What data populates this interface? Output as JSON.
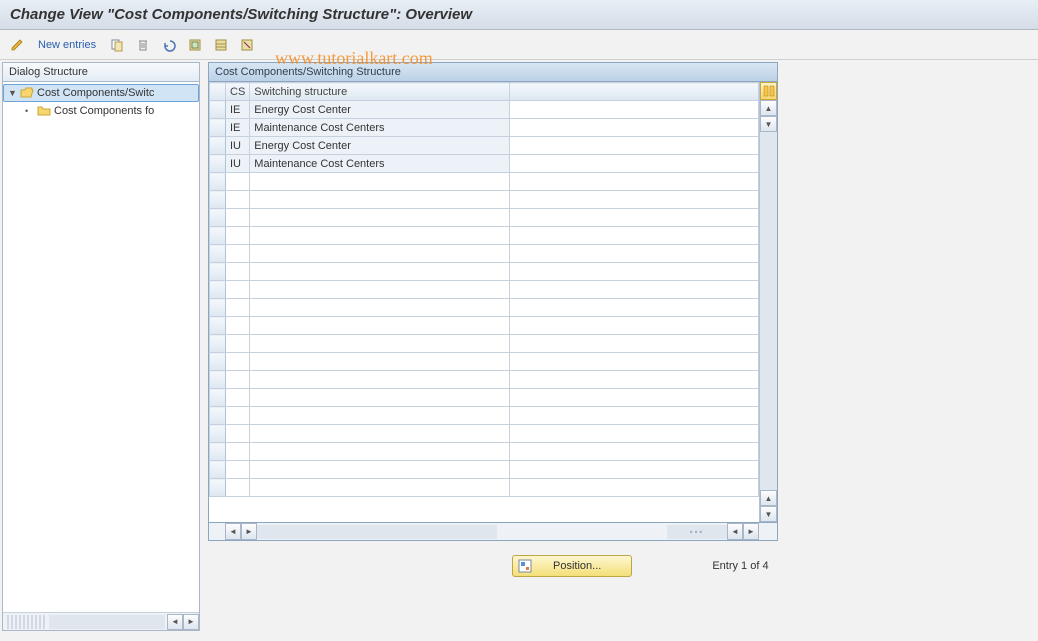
{
  "title": "Change View \"Cost Components/Switching Structure\": Overview",
  "toolbar": {
    "new_entries": "New entries"
  },
  "watermark": "www.tutorialkart.com",
  "sidebar": {
    "header": "Dialog Structure",
    "items": [
      {
        "label": "Cost Components/Switc",
        "selected": true,
        "open": true
      },
      {
        "label": "Cost Components fo",
        "child": true
      }
    ]
  },
  "table": {
    "title": "Cost Components/Switching Structure",
    "col1_header": "CS",
    "col2_header": "Switching structure",
    "rows": [
      {
        "cs": "IE",
        "desc": "Energy Cost Center"
      },
      {
        "cs": "IE",
        "desc": "Maintenance Cost Centers"
      },
      {
        "cs": "IU",
        "desc": "Energy Cost Center"
      },
      {
        "cs": "IU",
        "desc": "Maintenance Cost Centers"
      }
    ],
    "empty_rows": 18
  },
  "footer": {
    "position_btn": "Position...",
    "entry_label": "Entry 1 of 4"
  }
}
